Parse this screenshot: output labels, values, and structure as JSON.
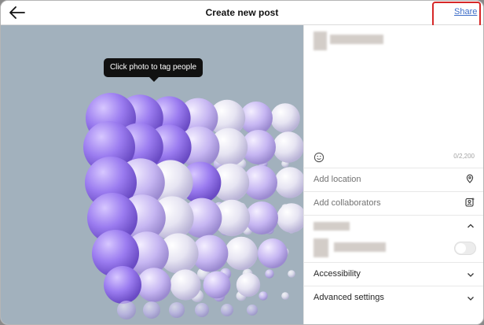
{
  "header": {
    "title": "Create new post",
    "share_label": "Share"
  },
  "photo": {
    "tooltip": "Click photo to tag people"
  },
  "panel": {
    "caption_counter": "0/2,200",
    "add_location": "Add location",
    "add_collaborators": "Add collaborators",
    "accessibility": "Accessibility",
    "advanced_settings": "Advanced settings"
  },
  "colors": {
    "accent": "#3d6dc8",
    "highlight": "#d62828",
    "photo_background": "#a2b1bd",
    "sphere_purple": "#9b7cf0",
    "sphere_white": "#f2f2f8"
  },
  "icons": {
    "back": "arrow-left-icon",
    "emoji": "smiley-icon",
    "location": "location-pin-icon",
    "collaborators": "person-plus-icon",
    "expand": "chevron-down-icon",
    "collapse": "chevron-up-icon"
  }
}
